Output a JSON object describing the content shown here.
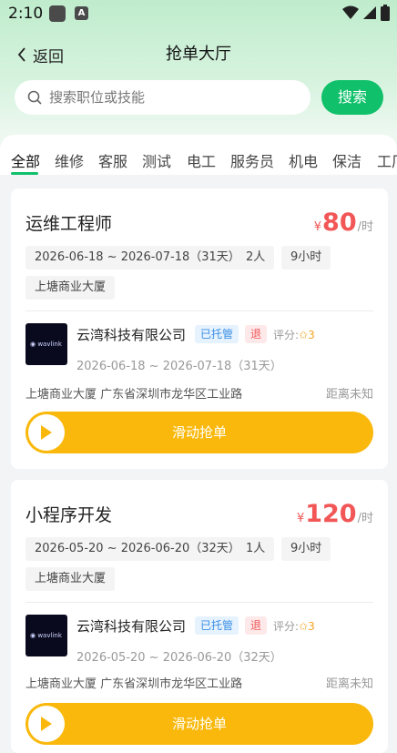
{
  "status_bar": {
    "time": "2:10",
    "app_icon_letter": "A"
  },
  "nav": {
    "back_label": "返回",
    "title": "抢单大厅"
  },
  "search": {
    "placeholder": "搜索职位或技能",
    "button_label": "搜索"
  },
  "tabs": [
    "全部",
    "维修",
    "客服",
    "测试",
    "电工",
    "服务员",
    "机电",
    "保洁",
    "工厂"
  ],
  "active_tab": "全部",
  "colors": {
    "accent": "#10c06a",
    "price": "#f25656",
    "slider": "#f9b80b",
    "badge_blue": "#3a8ee6"
  },
  "jobs": [
    {
      "title": "运维工程师",
      "currency": "¥",
      "price": "80",
      "unit": "/时",
      "date_range": "2026-06-18 ~ 2026-07-18（31天）",
      "people": "2人",
      "hours": "9小时",
      "location_tag": "上塘商业大厦",
      "company": "云湾科技有限公司",
      "badge_trust": "已托管",
      "badge_refund": "退",
      "rating_label": "评分:",
      "rating_value": "3",
      "company_date": "2026-06-18 ~ 2026-07-18（31天）",
      "address": "上塘商业大厦 广东省深圳市龙华区工业路",
      "distance": "距离未知",
      "slide_label": "滑动抢单"
    },
    {
      "title": "小程序开发",
      "currency": "¥",
      "price": "120",
      "unit": "/时",
      "date_range": "2026-05-20 ~ 2026-06-20（32天）",
      "people": "1人",
      "hours": "9小时",
      "location_tag": "上塘商业大厦",
      "company": "云湾科技有限公司",
      "badge_trust": "已托管",
      "badge_refund": "退",
      "rating_label": "评分:",
      "rating_value": "3",
      "company_date": "2026-05-20 ~ 2026-06-20（32天）",
      "address": "上塘商业大厦 广东省深圳市龙华区工业路",
      "distance": "距离未知",
      "slide_label": "滑动抢单"
    }
  ]
}
